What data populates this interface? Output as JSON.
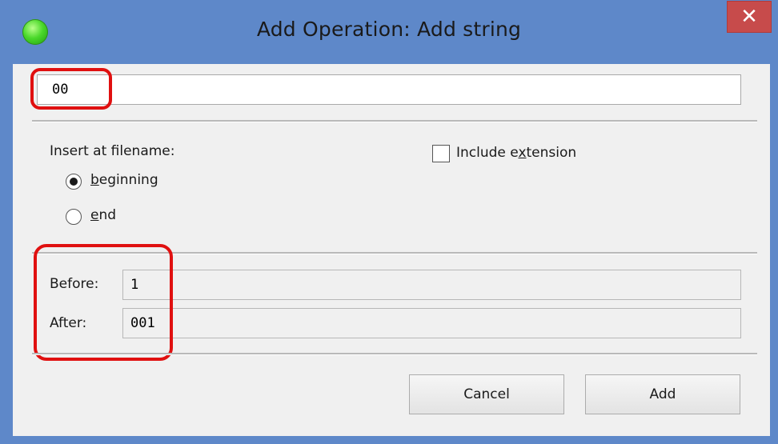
{
  "window": {
    "title": "Add Operation: Add string",
    "close_glyph": "✕"
  },
  "string_input": {
    "value": "00"
  },
  "insert": {
    "heading": "Insert at filename:",
    "option_beginning": {
      "label": "beginning",
      "selected": true
    },
    "option_end": {
      "label": "end",
      "selected": false
    }
  },
  "include_extension": {
    "label": "Include extension",
    "checked": false
  },
  "preview": {
    "before_label": "Before:",
    "before_value": "1",
    "after_label": "After:",
    "after_value": "001"
  },
  "buttons": {
    "cancel": "Cancel",
    "add": "Add"
  },
  "colors": {
    "titlebar": "#5e88c9",
    "close_button": "#c74b4b",
    "highlight": "#e01010",
    "dialog_bg": "#f0f0f0"
  },
  "icons": {
    "app": "green-circle-icon",
    "close": "close-icon"
  }
}
